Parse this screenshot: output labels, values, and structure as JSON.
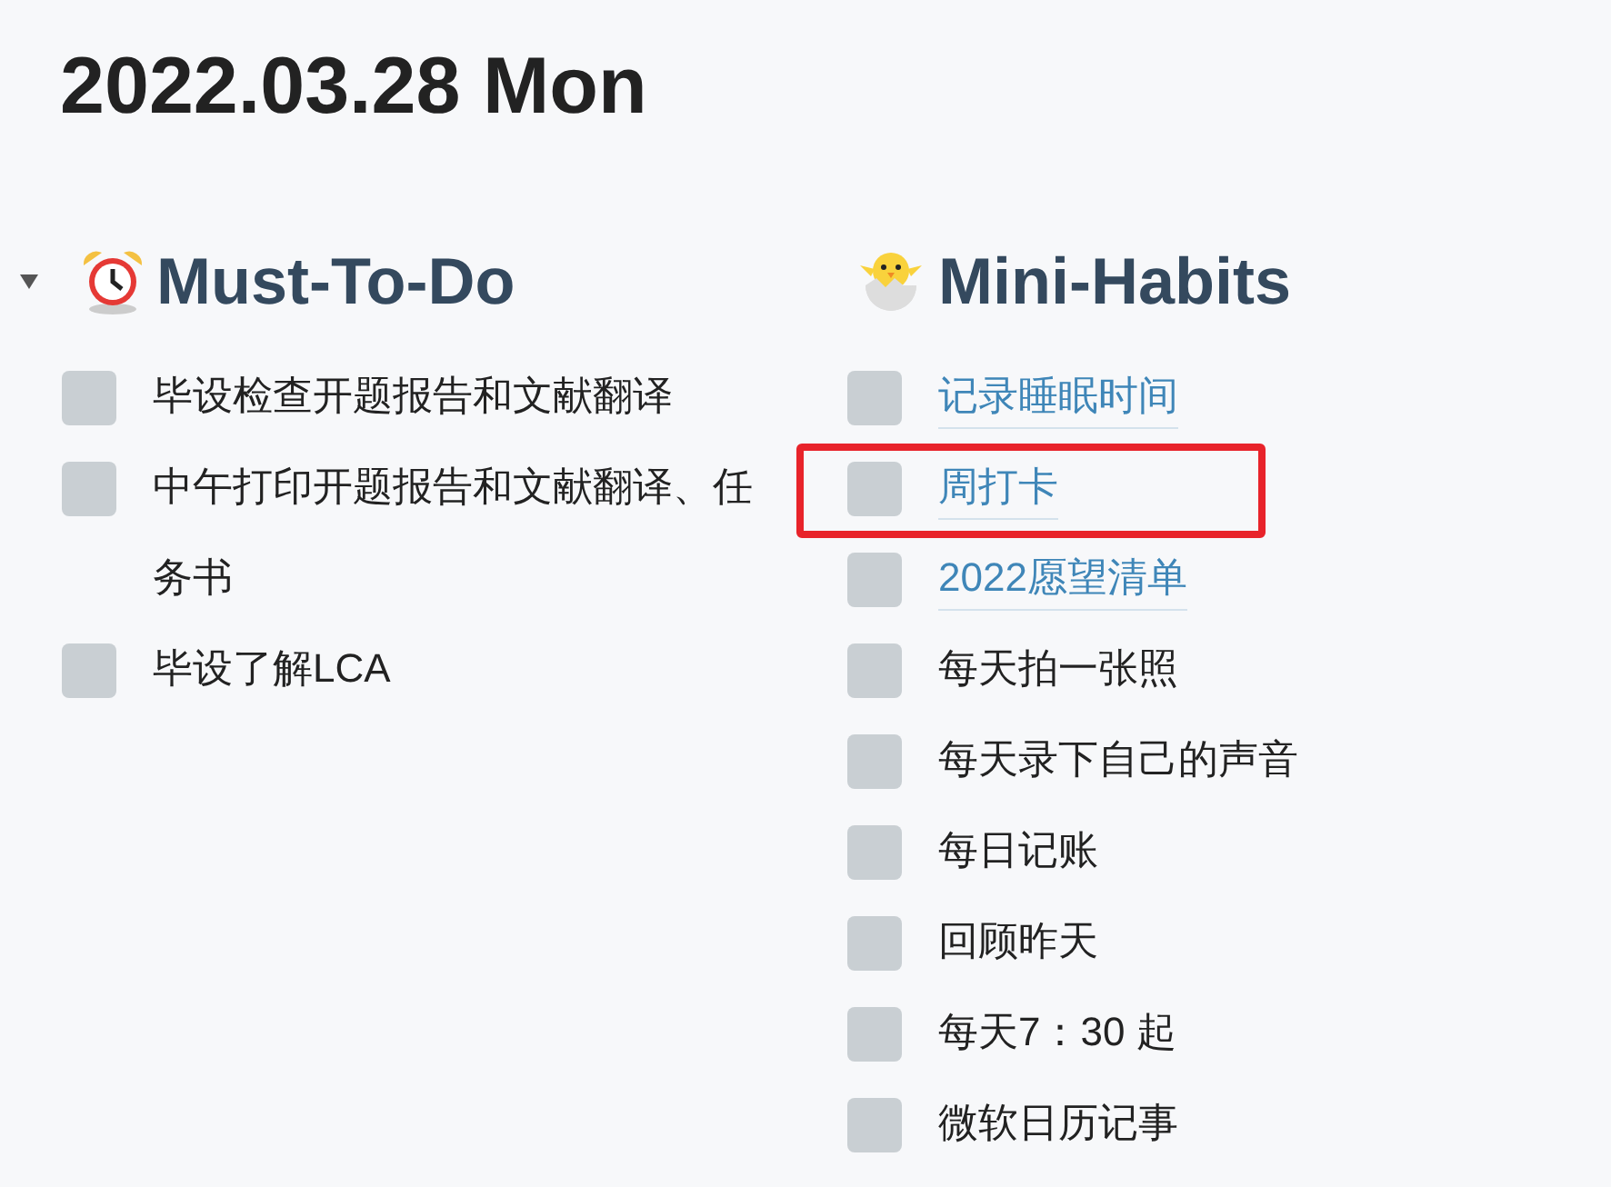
{
  "title": "2022.03.28 Mon",
  "sections": [
    {
      "heading": "Must-To-Do",
      "kind": "alarm",
      "expanded": true,
      "items": [
        {
          "text": "毕设检查开题报告和文献翻译",
          "kind": "plain",
          "checked": false,
          "highlighted": false
        },
        {
          "text": "中午打印开题报告和文献翻译、任务书",
          "kind": "plain",
          "checked": false,
          "highlighted": false
        },
        {
          "text": "毕设了解LCA",
          "kind": "plain",
          "checked": false,
          "highlighted": false
        }
      ]
    },
    {
      "heading": "Mini-Habits",
      "kind": "chick",
      "items": [
        {
          "text": "记录睡眠时间",
          "kind": "link",
          "checked": false,
          "highlighted": false
        },
        {
          "text": "周打卡",
          "kind": "link",
          "checked": false,
          "highlighted": true
        },
        {
          "text": "2022愿望清单",
          "kind": "link",
          "checked": false,
          "highlighted": false
        },
        {
          "text": "每天拍一张照",
          "kind": "plain",
          "checked": false,
          "highlighted": false
        },
        {
          "text": "每天录下自己的声音",
          "kind": "plain",
          "checked": false,
          "highlighted": false
        },
        {
          "text": "每日记账",
          "kind": "plain",
          "checked": false,
          "highlighted": false
        },
        {
          "text": "回顾昨天",
          "kind": "plain",
          "checked": false,
          "highlighted": false
        },
        {
          "text": "每天7：30 起",
          "kind": "plain",
          "checked": false,
          "highlighted": false
        },
        {
          "text": "微软日历记事",
          "kind": "plain",
          "checked": false,
          "highlighted": false
        }
      ]
    }
  ]
}
